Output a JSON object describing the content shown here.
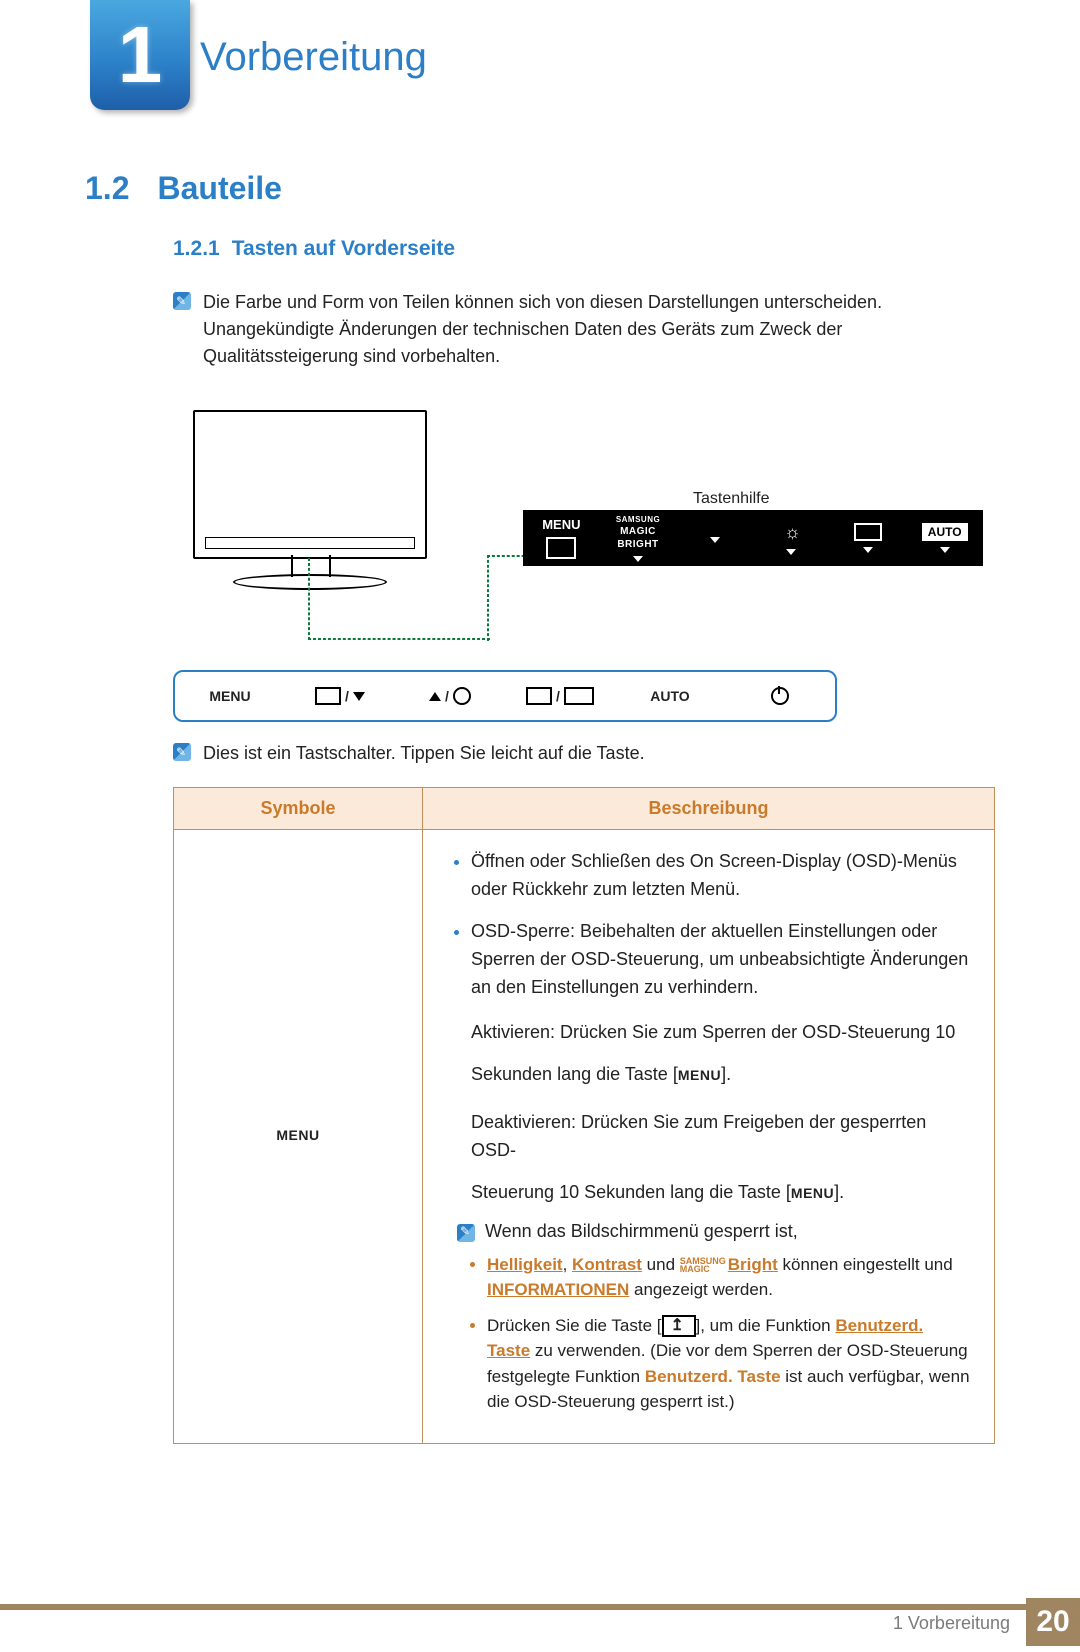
{
  "chapter": {
    "number": "1",
    "title": "Vorbereitung"
  },
  "section": {
    "number": "1.2",
    "title": "Bauteile"
  },
  "subsection": {
    "number": "1.2.1",
    "title": "Tasten auf Vorderseite"
  },
  "intro_note": "Die Farbe und Form von Teilen können sich von diesen Darstellungen unterscheiden. Unangekündigte Änderungen der technischen Daten des Geräts zum Zweck der Qualitätssteigerung sind vorbehalten.",
  "diagram": {
    "key_help_label": "Tastenhilfe",
    "osd_cells": {
      "menu": "MENU",
      "brand": "SAMSUNG",
      "magic": "MAGIC",
      "bright": "BRIGHT",
      "auto": "AUTO"
    }
  },
  "button_strip": {
    "menu": "MENU",
    "auto": "AUTO"
  },
  "touch_note": "Dies ist ein Tastschalter. Tippen Sie leicht auf die Taste.",
  "table": {
    "col_symbols": "Symbole",
    "col_desc": "Beschreibung",
    "row1": {
      "symbol": "MENU",
      "items": [
        "Öffnen oder Schließen des On Screen-Display (OSD)-Menüs oder Rückkehr zum letzten Menü.",
        "OSD-Sperre: Beibehalten der aktuellen Einstellungen oder Sperren der OSD-Steuerung, um unbeabsichtigte Änderungen an den Einstellungen zu verhindern."
      ],
      "activate_line_a": "Aktivieren: Drücken Sie zum Sperren der OSD-Steuerung 10",
      "activate_line_b_prefix": "Sekunden lang die Taste [",
      "activate_line_b_key": "MENU",
      "activate_line_b_suffix": "].",
      "deactivate_line_a": "Deaktivieren: Drücken Sie zum Freigeben der gesperrten OSD-",
      "deactivate_line_b_prefix": "Steuerung 10 Sekunden lang die Taste [",
      "deactivate_line_b_key": "MENU",
      "deactivate_line_b_suffix": "].",
      "locked_intro": "Wenn das Bildschirmmenü gesperrt ist,",
      "sub_items": {
        "a_parts": {
          "helligkeit": "Helligkeit",
          "sep1": ", ",
          "kontrast": "Kontrast",
          "und": " und ",
          "magic_prefix": "SAMSUNG MAGIC",
          "bright": "Bright",
          "tail": " können eingestellt und ",
          "informationen": "INFORMATIONEN",
          "tail2": " angezeigt werden."
        },
        "b_parts": {
          "lead": "Drücken Sie die Taste [",
          "after_icon": "], um die Funktion ",
          "benutzerd": "Benutzerd. Taste",
          "tail1": " zu verwenden. (Die vor dem Sperren der OSD-Steuerung festgelegte Funktion ",
          "benutzerd2": "Benutzerd. Taste",
          "tail2": " ist auch verfügbar, wenn die OSD-Steuerung gesperrt ist.)"
        }
      }
    }
  },
  "footer": {
    "breadcrumb": "1 Vorbereitung",
    "page": "20"
  }
}
